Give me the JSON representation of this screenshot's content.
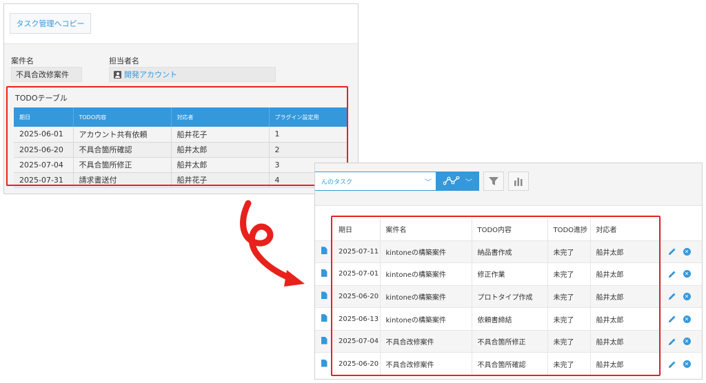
{
  "detail": {
    "copy_button": "タスク管理へコピー",
    "fields": {
      "case_label": "案件名",
      "case_value": "不具合改修案件",
      "owner_label": "担当者名",
      "owner_value": "開発アカウント"
    },
    "todo_table": {
      "title": "TODOテーブル",
      "headers": [
        "期日",
        "TODO内容",
        "対応者",
        "プラグイン設定用"
      ],
      "rows": [
        [
          "2025-06-01",
          "アカウント共有依頼",
          "船井花子",
          "1"
        ],
        [
          "2025-06-20",
          "不具合箇所確認",
          "船井太郎",
          "2"
        ],
        [
          "2025-07-04",
          "不具合箇所修正",
          "船井太郎",
          "3"
        ],
        [
          "2025-07-31",
          "請求書送付",
          "船井花子",
          "4"
        ]
      ]
    }
  },
  "list": {
    "view_select": "んのタスク",
    "headers": [
      "期日",
      "案件名",
      "TODO内容",
      "TODO進捗",
      "対応者"
    ],
    "rows": [
      [
        "2025-07-11",
        "kintoneの構築案件",
        "納品書作成",
        "未完了",
        "船井太郎"
      ],
      [
        "2025-07-01",
        "kintoneの構築案件",
        "修正作業",
        "未完了",
        "船井太郎"
      ],
      [
        "2025-06-20",
        "kintoneの構築案件",
        "プロトタイプ作成",
        "未完了",
        "船井太郎"
      ],
      [
        "2025-06-13",
        "kintoneの構築案件",
        "依頼書締結",
        "未完了",
        "船井太郎"
      ],
      [
        "2025-07-04",
        "不具合改修案件",
        "不具合箇所修正",
        "未完了",
        "船井太郎"
      ],
      [
        "2025-06-20",
        "不具合改修案件",
        "不具合箇所確認",
        "未完了",
        "船井太郎"
      ]
    ]
  },
  "colors": {
    "accent": "#3498db",
    "highlight": "#e8211d"
  }
}
